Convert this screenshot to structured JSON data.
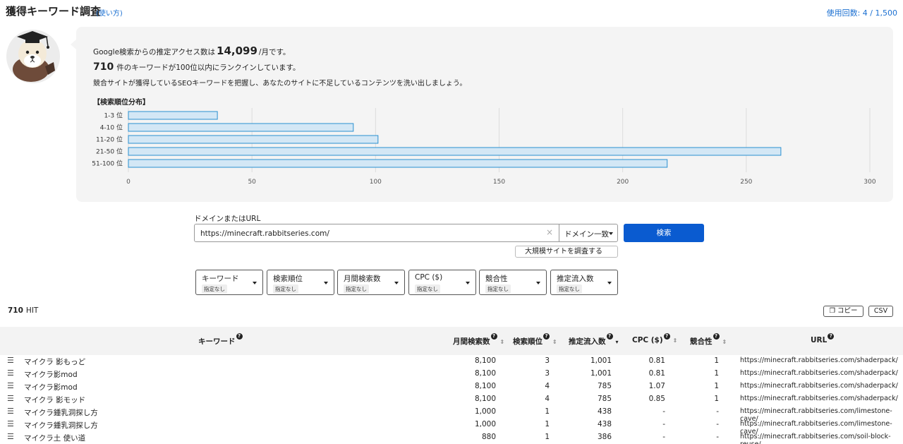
{
  "header": {
    "title": "獲得キーワード調査",
    "howto": "(使い方)",
    "usage": "使用回数: 4 / 1,500"
  },
  "summary": {
    "line1_prefix": "Google検索からの推定アクセス数は",
    "access_count": "14,099",
    "line1_suffix": "/月です。",
    "keyword_count": "710",
    "line2_suffix": "件のキーワードが100位以内にランクインしています。",
    "line3": "競合サイトが獲得しているSEOキーワードを把握し、あなたのサイトに不足しているコンテンツを洗い出しましょう。",
    "dist_title": "【検索順位分布】"
  },
  "chart_data": {
    "type": "bar",
    "orientation": "horizontal",
    "title": "【検索順位分布】",
    "categories": [
      "1-3 位",
      "4-10 位",
      "11-20 位",
      "21-50 位",
      "51-100 位"
    ],
    "values": [
      36,
      91,
      101,
      264,
      218
    ],
    "xlim": [
      0,
      300
    ],
    "x_ticks": [
      0,
      50,
      100,
      150,
      200,
      250,
      300
    ],
    "grid": true,
    "bar_fill": "#d3e7f5",
    "bar_stroke": "#2a8fd0"
  },
  "search": {
    "label": "ドメインまたはURL",
    "url_value": "https://minecraft.rabbitseries.com/",
    "clear_glyph": "×",
    "match_mode": "ドメイン一致",
    "search_button": "検索",
    "large_site_button": "大規模サイトを調査する"
  },
  "filters": [
    {
      "name": "キーワード",
      "value": "指定なし"
    },
    {
      "name": "検索順位",
      "value": "指定なし"
    },
    {
      "name": "月間検索数",
      "value": "指定なし"
    },
    {
      "name": "CPC ($)",
      "value": "指定なし"
    },
    {
      "name": "競合性",
      "value": "指定なし"
    },
    {
      "name": "推定流入数",
      "value": "指定なし"
    }
  ],
  "results": {
    "hit_count": "710",
    "hit_label": "HIT",
    "copy_button": "コピー",
    "csv_button": "CSV"
  },
  "table": {
    "headers": {
      "keyword": "キーワード",
      "volume": "月間検索数",
      "rank": "検索順位",
      "traffic": "推定流入数",
      "cpc": "CPC ($)",
      "competition": "競合性",
      "url": "URL"
    },
    "rows": [
      {
        "keyword": "マイクラ 影もっど",
        "volume": "8,100",
        "rank": "3",
        "traffic": "1,001",
        "cpc": "0.81",
        "competition": "1",
        "url": "https://minecraft.rabbitseries.com/shaderpack/"
      },
      {
        "keyword": "マイクラ影mod",
        "volume": "8,100",
        "rank": "3",
        "traffic": "1,001",
        "cpc": "0.81",
        "competition": "1",
        "url": "https://minecraft.rabbitseries.com/shaderpack/"
      },
      {
        "keyword": "マイクラ影mod",
        "volume": "8,100",
        "rank": "4",
        "traffic": "785",
        "cpc": "1.07",
        "competition": "1",
        "url": "https://minecraft.rabbitseries.com/shaderpack/"
      },
      {
        "keyword": "マイクラ 影モッド",
        "volume": "8,100",
        "rank": "4",
        "traffic": "785",
        "cpc": "0.85",
        "competition": "1",
        "url": "https://minecraft.rabbitseries.com/shaderpack/"
      },
      {
        "keyword": "マイクラ鍾乳洞探し方",
        "volume": "1,000",
        "rank": "1",
        "traffic": "438",
        "cpc": "-",
        "competition": "-",
        "url": "https://minecraft.rabbitseries.com/limestone-cave/"
      },
      {
        "keyword": "マイクラ鍾乳洞探し方",
        "volume": "1,000",
        "rank": "1",
        "traffic": "438",
        "cpc": "-",
        "competition": "-",
        "url": "https://minecraft.rabbitseries.com/limestone-cave/"
      },
      {
        "keyword": "マイクラ土 使い道",
        "volume": "880",
        "rank": "1",
        "traffic": "386",
        "cpc": "-",
        "competition": "-",
        "url": "https://minecraft.rabbitseries.com/soil-block-reuse/"
      }
    ]
  }
}
